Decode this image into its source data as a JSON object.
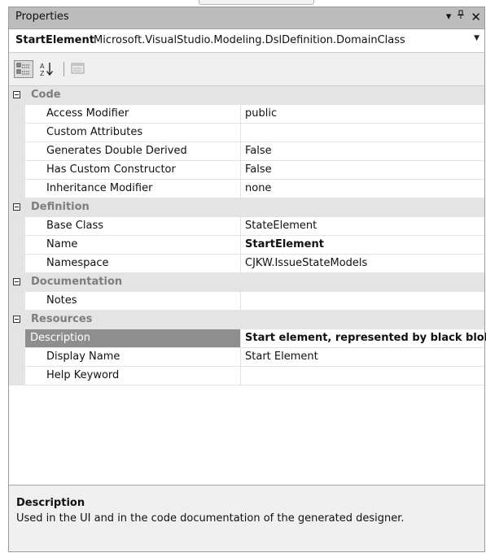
{
  "window": {
    "title": "Properties",
    "controls": {
      "dropdown": "▾",
      "pin": "ᛘ",
      "close": "✕"
    }
  },
  "object_selector": {
    "name": "StartElement",
    "type": "Microsoft.VisualStudio.Modeling.DslDefinition.DomainClass"
  },
  "toolbar": {
    "tools": [
      {
        "name": "categorized-icon",
        "active": true
      },
      {
        "name": "alphabetical-icon",
        "active": false
      },
      {
        "name": "property-pages-icon",
        "active": false
      }
    ]
  },
  "grid": {
    "categories": [
      {
        "label": "Code",
        "properties": [
          {
            "name": "Access Modifier",
            "value": "public"
          },
          {
            "name": "Custom Attributes",
            "value": ""
          },
          {
            "name": "Generates Double Derived",
            "value": "False"
          },
          {
            "name": "Has Custom Constructor",
            "value": "False"
          },
          {
            "name": "Inheritance Modifier",
            "value": "none"
          }
        ]
      },
      {
        "label": "Definition",
        "properties": [
          {
            "name": "Base Class",
            "value": "StateElement"
          },
          {
            "name": "Name",
            "value": "StartElement"
          },
          {
            "name": "Namespace",
            "value": "CJKW.IssueStateModels"
          }
        ]
      },
      {
        "label": "Documentation",
        "properties": [
          {
            "name": "Notes",
            "value": ""
          }
        ]
      },
      {
        "label": "Resources",
        "properties": [
          {
            "name": "Description",
            "value": "Start element, represented by black blob"
          },
          {
            "name": "Display Name",
            "value": "Start Element"
          },
          {
            "name": "Help Keyword",
            "value": ""
          }
        ]
      }
    ],
    "selected_property": "Description"
  },
  "description_pane": {
    "title": "Description",
    "text": "Used in the UI and in the code documentation of the generated designer."
  },
  "colors": {
    "title_bar": "#bcbcbc",
    "category_row": "#e4e4e4",
    "selected_row": "#8e8e8e"
  }
}
